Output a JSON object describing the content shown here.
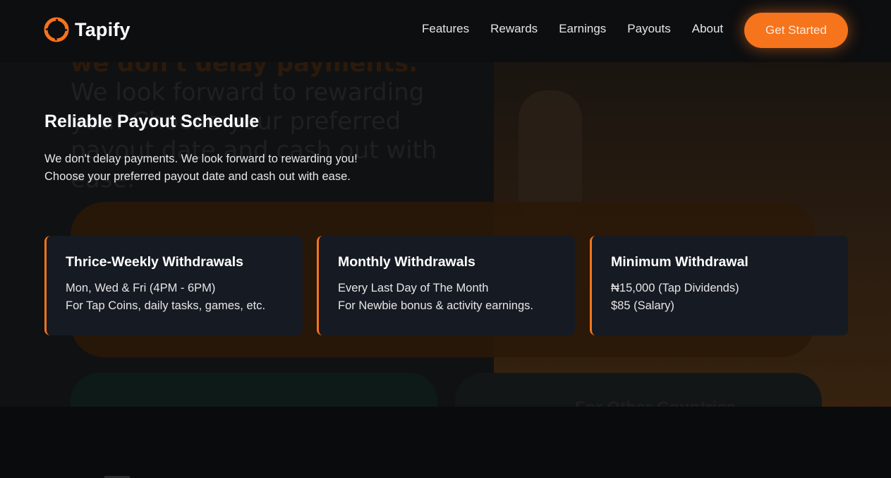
{
  "brand": {
    "name": "Tapify",
    "accent_color": "#f5741c"
  },
  "nav": {
    "items": [
      {
        "label": "Features"
      },
      {
        "label": "Rewards"
      },
      {
        "label": "Earnings"
      },
      {
        "label": "Payouts"
      },
      {
        "label": "About"
      }
    ],
    "cta_label": "Get Started"
  },
  "background": {
    "ghost_highlight": "we don't delay payments.",
    "ghost_text": " We look forward to rewarding you! Choose your preferred payout date and cash out with ease.",
    "ghost_card_title": "For Other Countries"
  },
  "section": {
    "title": "Reliable Payout Schedule",
    "desc_line1": "We don't delay payments. We look forward to rewarding you!",
    "desc_line2": "Choose your preferred payout date and cash out with ease."
  },
  "cards": [
    {
      "title": "Thrice-Weekly Withdrawals",
      "line1": "Mon, Wed & Fri (4PM - 6PM)",
      "line2": "For Tap Coins, daily tasks, games, etc."
    },
    {
      "title": "Monthly Withdrawals",
      "line1": "Every Last Day of The Month",
      "line2": "For Newbie bonus & activity earnings."
    },
    {
      "title": "Minimum Withdrawal",
      "line1": "₦15,000 (Tap Dividends)",
      "line2": "$85 (Salary)"
    }
  ]
}
